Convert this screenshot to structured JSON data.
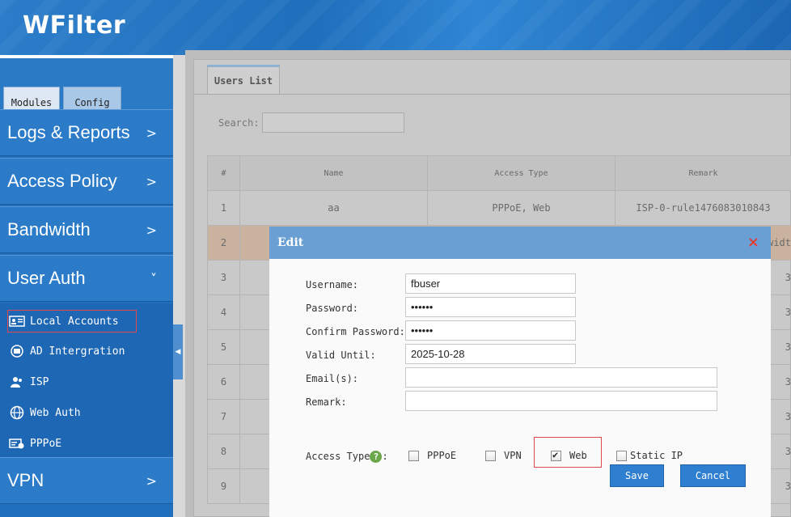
{
  "app": {
    "brand": "WFilter"
  },
  "sidebar": {
    "tabs": [
      {
        "label": "Modules"
      },
      {
        "label": "Config"
      }
    ],
    "items": [
      {
        "label": "Logs & Reports",
        "chevron": ">"
      },
      {
        "label": "Access Policy",
        "chevron": ">"
      },
      {
        "label": "Bandwidth",
        "chevron": ">"
      },
      {
        "label": "User Auth",
        "chevron": "˅"
      },
      {
        "label": "VPN",
        "chevron": ">"
      }
    ],
    "user_auth_sub": [
      {
        "label": "Local Accounts",
        "icon": "id-card-icon"
      },
      {
        "label": "AD Intergration",
        "icon": "directory-icon"
      },
      {
        "label": "ISP",
        "icon": "users-icon"
      },
      {
        "label": "Web Auth",
        "icon": "globe-icon"
      },
      {
        "label": "PPPoE",
        "icon": "pppoe-icon"
      }
    ]
  },
  "main": {
    "tab_label": "Users List",
    "search_label": "Search:",
    "table": {
      "headers": [
        "#",
        "Name",
        "Access Type",
        "Remark"
      ],
      "rows": [
        {
          "num": "1",
          "name": "aa",
          "access": "PPPoE, Web",
          "remark": "ISP-0-rule1476083010843"
        },
        {
          "num": "2",
          "name": "",
          "access": "",
          "remark": "widt"
        },
        {
          "num": "3",
          "name": "",
          "access": "",
          "remark": "3"
        },
        {
          "num": "4",
          "name": "",
          "access": "",
          "remark": "3"
        },
        {
          "num": "5",
          "name": "",
          "access": "",
          "remark": "3"
        },
        {
          "num": "6",
          "name": "",
          "access": "",
          "remark": "3"
        },
        {
          "num": "7",
          "name": "",
          "access": "",
          "remark": "3"
        },
        {
          "num": "8",
          "name": "",
          "access": "",
          "remark": "3"
        },
        {
          "num": "9",
          "name": "",
          "access": "",
          "remark": "3"
        }
      ]
    }
  },
  "modal": {
    "title": "Edit",
    "close": "×",
    "fields": {
      "username_label": "Username:",
      "username_value": "fbuser",
      "password_label": "Password:",
      "password_value": "••••••",
      "confirm_label": "Confirm Password:",
      "confirm_value": "••••••",
      "valid_label": "Valid Until:",
      "valid_value": "2025-10-28",
      "email_label": "Email(s):",
      "email_value": "",
      "remark_label": "Remark:",
      "remark_value": "",
      "access_label": "Access Type",
      "access_help": "?",
      "access_colon": ":"
    },
    "access_types": [
      {
        "label": "PPPoE",
        "checked": false
      },
      {
        "label": "VPN",
        "checked": false
      },
      {
        "label": "Web",
        "checked": true
      },
      {
        "label": "Static IP",
        "checked": false
      }
    ],
    "save_label": "Save",
    "cancel_label": "Cancel"
  },
  "colors": {
    "header": "#2b7dc9",
    "sidebar": "#1f6fbd",
    "modal_header": "#6a9fd3",
    "button": "#2f7fd1",
    "highlight": "#e0484b"
  }
}
